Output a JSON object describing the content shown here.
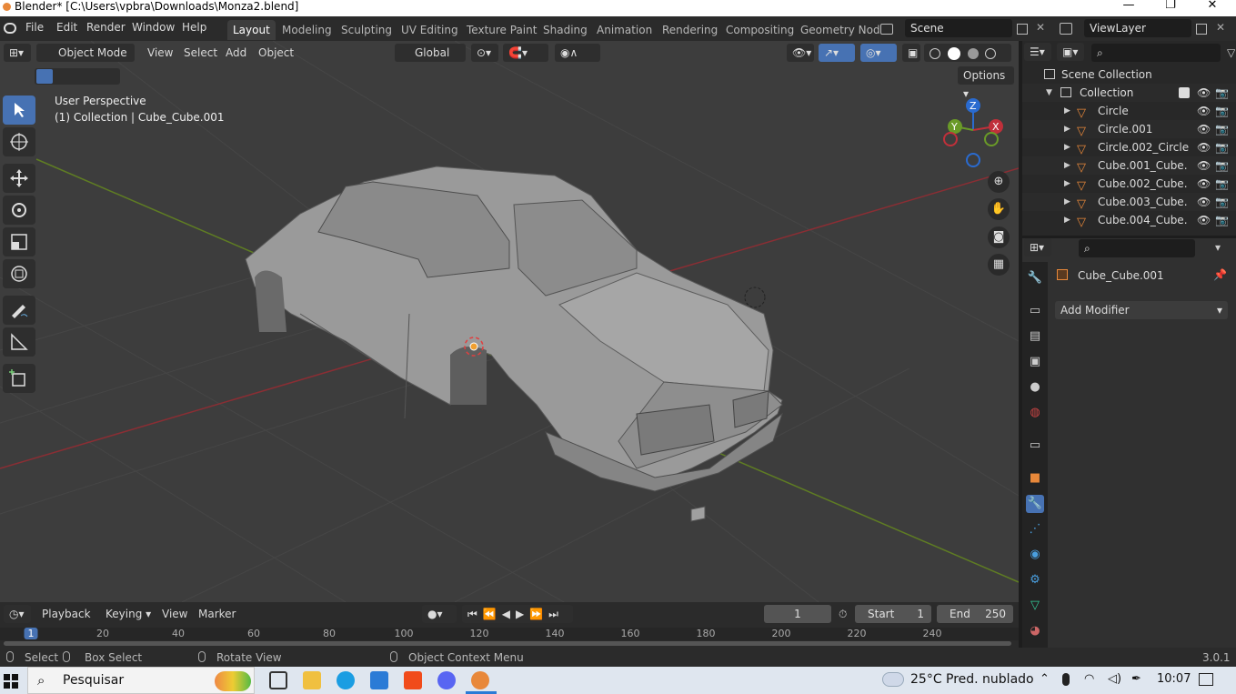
{
  "window": {
    "title": "Blender* [C:\\Users\\vpbra\\Downloads\\Monza2.blend]",
    "minimize": "—",
    "maximize": "❐",
    "close": "✕"
  },
  "menubar": {
    "items": [
      "File",
      "Edit",
      "Render",
      "Window",
      "Help"
    ],
    "workspaces": [
      "Layout",
      "Modeling",
      "Sculpting",
      "UV Editing",
      "Texture Paint",
      "Shading",
      "Animation",
      "Rendering",
      "Compositing",
      "Geometry Nod"
    ],
    "scene": "Scene",
    "view_layer": "ViewLayer"
  },
  "viewport": {
    "mode": "Object Mode",
    "menus": [
      "View",
      "Select",
      "Add",
      "Object"
    ],
    "orientation": "Global",
    "options": "Options",
    "perspective": "User Perspective",
    "collection_info": "(1) Collection | Cube_Cube.001",
    "gizmo": {
      "x": "X",
      "y": "Y",
      "z": "Z"
    }
  },
  "outliner": {
    "scene_collection": "Scene Collection",
    "collection": "Collection",
    "objects": [
      "Circle",
      "Circle.001",
      "Circle.002_Circle",
      "Cube.001_Cube.",
      "Cube.002_Cube.",
      "Cube.003_Cube.",
      "Cube.004_Cube."
    ]
  },
  "properties": {
    "object_name": "Cube_Cube.001",
    "add_modifier": "Add Modifier"
  },
  "timeline": {
    "menus": [
      "Playback",
      "Keying",
      "View",
      "Marker"
    ],
    "current_frame": "1",
    "start_label": "Start",
    "start": "1",
    "end_label": "End",
    "end": "250",
    "ticks": [
      "1",
      "20",
      "40",
      "60",
      "80",
      "100",
      "120",
      "140",
      "160",
      "180",
      "200",
      "220",
      "240"
    ]
  },
  "statusbar": {
    "select": "Select",
    "box_select": "Box Select",
    "rotate_view": "Rotate View",
    "context_menu": "Object Context Menu",
    "version": "3.0.1"
  },
  "taskbar": {
    "search": "Pesquisar",
    "temperature": "25°C",
    "weather": "Pred. nublado",
    "time": "10:07"
  },
  "colors": {
    "accent": "#4772b3",
    "viewport_bg": "#3d3d3d",
    "panel_bg": "#2b2b2b",
    "object_icon": "#e8883a",
    "x_axis": "#c0303a",
    "y_axis": "#6a9a28",
    "z_axis": "#2a6bd0"
  }
}
